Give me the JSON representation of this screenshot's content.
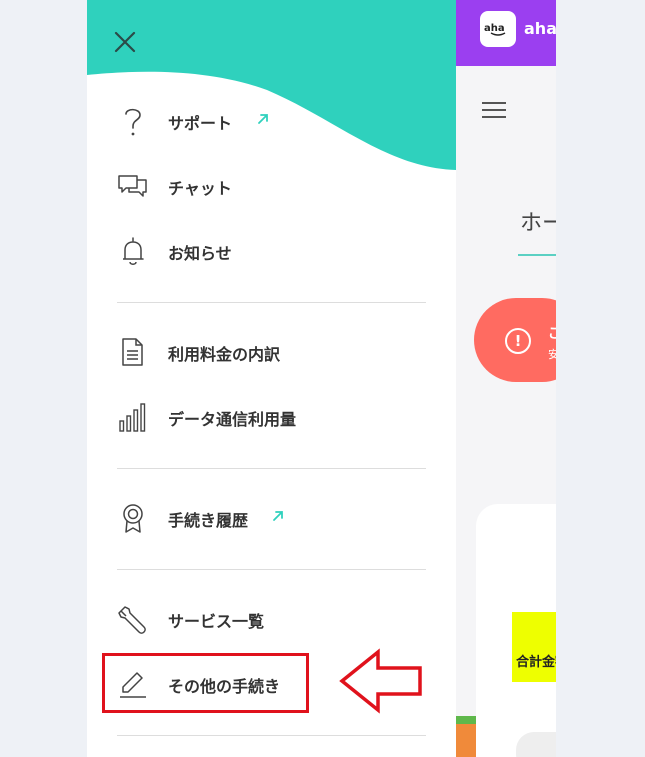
{
  "app": {
    "brand": "aha",
    "home_title": "ホーム",
    "alert_line1": "ご",
    "alert_line2": "安",
    "alert_icon": "!",
    "total_label": "合計金額"
  },
  "menu": {
    "items": [
      {
        "label": "サポート",
        "icon": "question-icon",
        "external": true
      },
      {
        "label": "チャット",
        "icon": "chat-icon",
        "external": false
      },
      {
        "label": "お知らせ",
        "icon": "bell-icon",
        "external": false
      },
      {
        "label": "利用料金の内訳",
        "icon": "document-icon",
        "external": false
      },
      {
        "label": "データ通信利用量",
        "icon": "bar-chart-icon",
        "external": false
      },
      {
        "label": "手続き履歴",
        "icon": "award-icon",
        "external": true
      },
      {
        "label": "サービス一覧",
        "icon": "wrench-icon",
        "external": false
      },
      {
        "label": "その他の手続き",
        "icon": "pencil-icon",
        "external": false
      }
    ]
  },
  "colors": {
    "accent_teal": "#2fd1bd",
    "brand_purple": "#9b3ff0",
    "alert_red": "#ff6b61",
    "annotation_red": "#e0121c",
    "highlight_yellow": "#eeff00"
  }
}
